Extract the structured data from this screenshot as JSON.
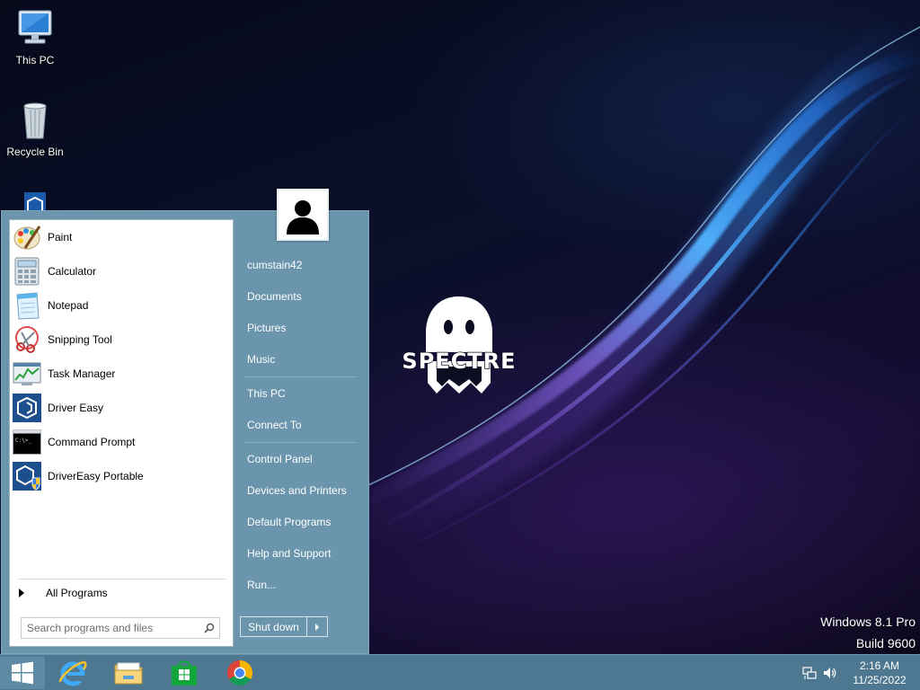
{
  "desktop": {
    "icons": [
      {
        "label": "This PC",
        "icon": "computer-icon"
      },
      {
        "label": "Recycle Bin",
        "icon": "recycle-bin-icon"
      },
      {
        "label": "",
        "icon": "driver-easy-icon"
      }
    ],
    "watermark": {
      "edition": "Windows 8.1 Pro",
      "build": "Build 9600"
    },
    "logo_text": "SPECTRE"
  },
  "start_menu": {
    "programs": [
      {
        "label": "Paint",
        "icon": "paint-icon"
      },
      {
        "label": "Calculator",
        "icon": "calculator-icon"
      },
      {
        "label": "Notepad",
        "icon": "notepad-icon"
      },
      {
        "label": "Snipping Tool",
        "icon": "snipping-tool-icon"
      },
      {
        "label": "Task Manager",
        "icon": "task-manager-icon"
      },
      {
        "label": "Driver Easy",
        "icon": "driver-easy-icon"
      },
      {
        "label": "Command Prompt",
        "icon": "command-prompt-icon"
      },
      {
        "label": "DriverEasy Portable",
        "icon": "driver-easy-portable-icon"
      }
    ],
    "all_programs": "All Programs",
    "search_placeholder": "Search programs and files",
    "right_column": {
      "user": "cumstain42",
      "group1": [
        "Documents",
        "Pictures",
        "Music"
      ],
      "group2": [
        "This PC",
        "Connect To"
      ],
      "group3": [
        "Control Panel",
        "Devices and Printers",
        "Default Programs",
        "Help and Support",
        "Run..."
      ]
    },
    "shutdown_label": "Shut down",
    "accent_color": "#6a95ac"
  },
  "taskbar": {
    "pinned": [
      "windows-start-icon",
      "internet-explorer-icon",
      "file-explorer-icon",
      "windows-store-icon",
      "chrome-icon"
    ],
    "tray_icons": [
      "network-icon",
      "volume-icon"
    ],
    "clock": {
      "time": "2:16 AM",
      "date": "11/25/2022"
    },
    "color": "#4e7891"
  }
}
